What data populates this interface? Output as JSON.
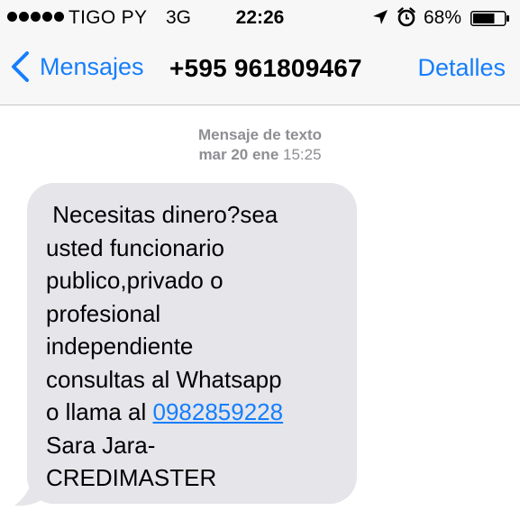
{
  "status_bar": {
    "carrier": "TIGO PY",
    "network": "3G",
    "time": "22:26",
    "battery": "68%",
    "battery_level": 0.68,
    "icons": [
      "signal-dots",
      "location-arrow-icon",
      "alarm-clock-icon",
      "battery-icon"
    ]
  },
  "nav": {
    "back_label": "Mensajes",
    "title": "+595 961809467",
    "details_label": "Detalles",
    "accent_color": "#157efb"
  },
  "conversation": {
    "timestamp_label": "Mensaje de texto",
    "timestamp_day": "mar 20 ene",
    "timestamp_time": "15:25",
    "message": {
      "lines": [
        " Necesitas dinero?sea",
        "usted funcionario",
        "publico,privado o",
        "profesional",
        "independiente",
        "consultas al Whatsapp"
      ],
      "call_prefix": "o llama al ",
      "phone_link": "0982859228",
      "signature_lines": [
        "Sara Jara-",
        "CREDIMASTER"
      ],
      "bubble_color": "#e5e5ea"
    }
  }
}
